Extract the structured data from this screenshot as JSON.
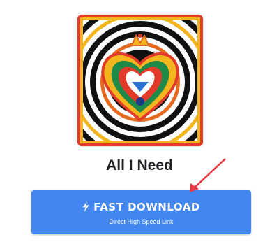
{
  "track": {
    "title": "All I Need"
  },
  "download_button": {
    "label": "FAST DOWNLOAD",
    "sublabel": "Direct High Speed Link",
    "icon": "lightning-bolt-icon"
  },
  "colors": {
    "button": "#4286f0",
    "arrow": "#e5383f",
    "title": "#202124"
  }
}
